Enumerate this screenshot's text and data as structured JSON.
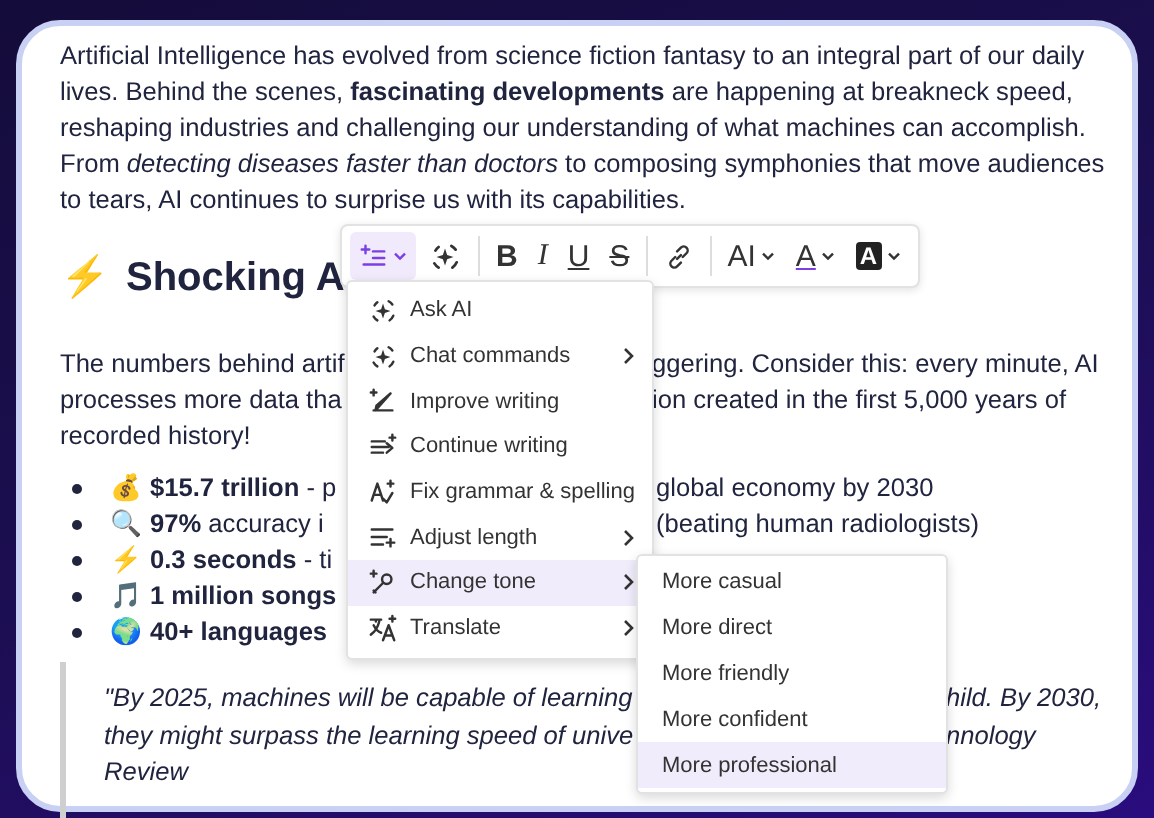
{
  "intro": "Artificial Intelligence has evolved from science fiction fantasy to an integral part of our daily lives. Behind the scenes, **fascinating developments** are happening at breakneck speed, reshaping industries and challenging our understanding of what machines can accomplish. From *detecting diseases faster than doctors* to composing symphonies that move audiences to tears, AI continues to surprise us with its capabilities.",
  "heading": {
    "emoji": "⚡",
    "text": "Shocking A"
  },
  "numbers_lines": [
    {
      "left": "The numbers behind artif",
      "right": "ggering. Consider this: every minute, AI"
    },
    {
      "left": "processes more data tha",
      "right": "ion created in the first 5,000 years of"
    },
    {
      "left": "recorded history!"
    }
  ],
  "bullets": [
    {
      "emoji": "💰",
      "left": "**$15.7 trillion** - p",
      "right": "global economy by 2030"
    },
    {
      "emoji": "🔍",
      "left": "**97%** accuracy i",
      "right": "(beating human radiologists)"
    },
    {
      "emoji": "⚡",
      "left": "**0.3 seconds** - ti"
    },
    {
      "emoji": "🎵",
      "left": "**1 million songs**"
    },
    {
      "emoji": "🌍",
      "left": "**40+ languages**"
    }
  ],
  "quote_lines": [
    {
      "left": "\"By 2025, machines will be capable of learning",
      "right": "hild. By 2030,"
    },
    {
      "left": "they might surpass the learning speed of unive",
      "right": "nnology"
    },
    {
      "left": "Review"
    }
  ],
  "toolbar": [
    {
      "kind": "ai-menu",
      "selected": true
    },
    {
      "kind": "ai",
      "selected": false
    },
    {
      "kind": "divider"
    },
    {
      "kind": "bold",
      "label": "B",
      "selected": false
    },
    {
      "kind": "italic",
      "label": "I",
      "selected": false
    },
    {
      "kind": "underline",
      "label": "U",
      "selected": false
    },
    {
      "kind": "strike",
      "label": "S",
      "selected": false
    },
    {
      "kind": "divider"
    },
    {
      "kind": "link",
      "selected": false
    },
    {
      "kind": "divider"
    },
    {
      "kind": "size",
      "label": "AI",
      "selected": false
    },
    {
      "kind": "color",
      "label": "A",
      "selected": false
    },
    {
      "kind": "highlight",
      "label": "A",
      "selected": false
    }
  ],
  "menu": [
    {
      "label": "Ask AI",
      "submenu": false,
      "selected": false
    },
    {
      "label": "Chat commands",
      "submenu": true,
      "selected": false
    },
    {
      "label": "Improve writing",
      "submenu": false,
      "selected": false
    },
    {
      "label": "Continue writing",
      "submenu": false,
      "selected": false
    },
    {
      "label": "Fix grammar & spelling",
      "submenu": false,
      "selected": false
    },
    {
      "label": "Adjust length",
      "submenu": true,
      "selected": false
    },
    {
      "label": "Change tone",
      "submenu": true,
      "selected": true
    },
    {
      "label": "Translate",
      "submenu": true,
      "selected": false
    }
  ],
  "submenu": [
    {
      "label": "More casual",
      "selected": false
    },
    {
      "label": "More direct",
      "selected": false
    },
    {
      "label": "More friendly",
      "selected": false
    },
    {
      "label": "More confident",
      "selected": false
    },
    {
      "label": "More professional",
      "selected": true
    }
  ]
}
